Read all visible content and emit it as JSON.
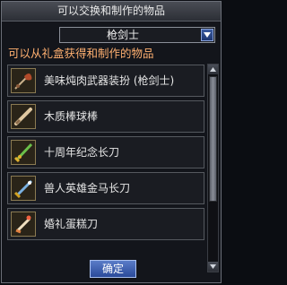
{
  "window": {
    "title": "可以交换和制作的物品"
  },
  "filter": {
    "selected": "枪剑士"
  },
  "section": {
    "title": "可以从礼盒获得和制作的物品"
  },
  "items": [
    {
      "label": "美味炖肉武器装扮 (枪剑士)",
      "icon": "meat-weapon-icon"
    },
    {
      "label": "木质棒球棒",
      "icon": "baseball-bat-icon"
    },
    {
      "label": "十周年纪念长刀",
      "icon": "anniversary-sword-icon"
    },
    {
      "label": "兽人英雄金马长刀",
      "icon": "orc-hero-sword-icon"
    },
    {
      "label": "婚礼蛋糕刀",
      "icon": "cake-knife-icon"
    }
  ],
  "footer": {
    "confirm_label": "确定"
  },
  "colors": {
    "accent": "#ffb070",
    "button": "#3a5aa0"
  }
}
